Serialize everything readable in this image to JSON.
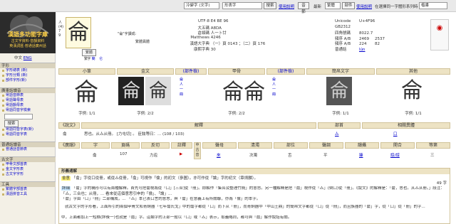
{
  "topbar": {
    "mode_select": "冷僻字 (文字)",
    "query_select": "形表字",
    "search_button": "搜索",
    "help_link": "使用說明",
    "chars_label": "繁體",
    "search2_button": "音節",
    "recent_label": "最新",
    "help2_link": "使用說明",
    "parts_label": "部件",
    "hint_text": "在選擇同一字體形系列時",
    "style_select": "楷書"
  },
  "logo": {
    "title": "漢語多功能字庫",
    "subtitle": "古文字資料·音韻資料",
    "subtitle2": "英漢詞匯·普通話廣州話",
    "lang_zh": "中文",
    "lang_en": "ENG"
  },
  "sidebar": {
    "sec1": "字形",
    "sec1_items": [
      "字形總表 (新)",
      "字形分類 (新)",
      "部件字形(新)"
    ],
    "sec2": "廣東話讀音",
    "sec2_items": [
      "粵語音節表",
      "粵語聲母表",
      "粵語韻母表"
    ],
    "sec2_extra": "粵語同音字檢索",
    "search_placeholder": "",
    "search_button": "搜索",
    "sec2_items2": [
      "粵語同音字表(新)",
      "粵語同音字表"
    ],
    "sec3": "普通話讀音",
    "sec3_items": [
      "普通話音節表"
    ],
    "sec4": "古文字",
    "sec4_items": [
      "甲骨文部首表",
      "金文字形表",
      "古文字字形"
    ],
    "sec5": "工具",
    "sec5_items": [
      "繁體字部首表",
      "漢語拼音工具"
    ]
  },
  "info": {
    "page_top": "人",
    "page_num": "(4)",
    "radical_num": "7",
    "stroke_label": "9",
    "char": "侖",
    "char_desc": "\"侖\"字讀成:",
    "variant_label": "異體字",
    "traditional_label": "繁體字",
    "tag_traditional": "繁",
    "tag_simplified": "簡",
    "simplified_val": "仑",
    "variant_heading": "繁體異體"
  },
  "codes": {
    "rows": [
      {
        "k": "UTF-8",
        "v": "E4 BE 96"
      },
      {
        "k": "大五碼",
        "v": "A8DA"
      },
      {
        "k": "倉頡碼",
        "v": "人一卜廿"
      },
      {
        "k": "Matthews",
        "v": "4246"
      },
      {
        "k": "漢語大字典",
        "v": "（一）頁 0143 ；（二）頁 176"
      },
      {
        "k": "康熙字典",
        "v": "30"
      }
    ],
    "rows2": [
      {
        "k": "Unicode",
        "v": "U+4F96"
      },
      {
        "k": "GB2312",
        "v": ""
      },
      {
        "k": "四角號碼",
        "v": "8022.7"
      },
      {
        "k": "頻序 A/B",
        "v": "2469",
        "v2": "2537"
      },
      {
        "k": "頻序 A/B",
        "v": "224",
        "v2": "82"
      },
      {
        "k": "普通話",
        "v": "lún"
      }
    ]
  },
  "forms": {
    "headers": [
      "小篆",
      "金文",
      "(部件檢)",
      "甲骨",
      "(部件檢)",
      "簡帛文字",
      "其他"
    ],
    "counts": [
      "字例: 1/1",
      "字例: 2/2",
      "",
      "字例: 2/2",
      "",
      "字例: 1/1",
      "字例: 1/1"
    ],
    "parts": [
      "侖",
      "人",
      "一",
      "冊"
    ],
    "parts2": [
      "侖",
      "人",
      "一",
      "冊"
    ]
  },
  "shuowen": {
    "label": "《說文》",
    "explanation_head": "解釋",
    "explanation": "思也。从亼从冊。 [力屯切] 。 臣鉉等曰：... (108 / 103)",
    "radical_head": "部首",
    "radical": "亼",
    "radical_val": "口",
    "related_head": "相關異體",
    "related": "口"
  },
  "guangyun": {
    "label": "《廣韻》",
    "cols": [
      "字",
      "頁碼",
      "反切",
      "註釋",
      "中古音"
    ],
    "row": [
      "侖",
      "107",
      "力迍",
      "▶"
    ],
    "mid_cols": [
      "聲母",
      "清濁",
      "部位",
      "聲調",
      "韻攝",
      "開合",
      "等第"
    ],
    "mid_vals": [
      "來",
      "次濁",
      "舌",
      "平",
      "臻",
      "合",
      "三"
    ],
    "mid_links": [
      "來",
      "",
      "",
      "平",
      "諄",
      "諄/諄",
      "合"
    ]
  },
  "etymology": {
    "title": "形義通解",
    "line1_tag": "會意",
    "line1": "「侖」字從口從冊，或從亼從冊，「侖」可視作「倫」的初文（參圖）。亦可作從「論」字的初文（章炳麟）。",
    "counter": "49 字",
    "line2_tag": "詳細",
    "line2": "「侖」字的構形可以有兩種解釋。首先可把侖視為從「口」[三合]從「冊」。即解作「集合及整理竹簡」的意思。另一種解釋是把「侖」視作從「亼」(倒口)從「冊」。《說文》的解釋是：「侖，思也。从亼从冊。」段注：「亼，三合也；从冊，... 看來從這個意思引申的「倫」、「論」...",
    "line3": "「侖」字由「口」「冊」二部構成，... 「亼」本已表口言的意思，與「侖」在意義上有所關聯，亦為「倫」的本字。",
    "line4": "就古文字的字形看，上面所引的兩個甲骨文和青銅器「七年侖氏戈」中的侖字都從「口」而下从「冊」，而青銅器中「中山王鼎」的簡帛文字都從「口」從「冊」，而且族器的「侖」字，從「口」從「冊」的字...",
    "line5": "中，上面都加上一短横(詳後一)也就是「侖」字。這類字的上部一般以「口」或「亼」表示，取義略同，都可與「侖」解作說話有關。"
  }
}
